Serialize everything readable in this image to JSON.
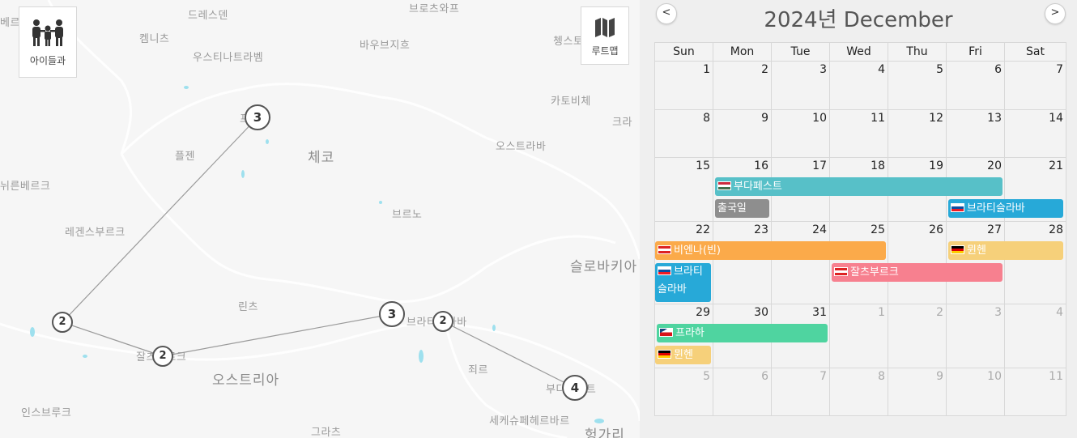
{
  "map": {
    "buttons": {
      "kids_label": "아이들과",
      "route_label": "루트맵"
    },
    "places": [
      {
        "id": "dresden",
        "text": "드레스덴"
      },
      {
        "id": "bros",
        "text": "브로츠와프"
      },
      {
        "id": "chemnitz",
        "text": "켐니츠"
      },
      {
        "id": "bautzen",
        "text": "바우브지흐"
      },
      {
        "id": "chenst",
        "text": "쳉스토"
      },
      {
        "id": "usti",
        "text": "우스티나트라벰"
      },
      {
        "id": "katowice",
        "text": "카토비체"
      },
      {
        "id": "krak",
        "text": "크라"
      },
      {
        "id": "plzen",
        "text": "플젠"
      },
      {
        "id": "czech",
        "text": "체코"
      },
      {
        "id": "ostrava",
        "text": "오스트라바"
      },
      {
        "id": "nurnberg",
        "text": "뉘른베르크"
      },
      {
        "id": "brno",
        "text": "브르노"
      },
      {
        "id": "regensburg",
        "text": "레겐스부르크"
      },
      {
        "id": "slovakia",
        "text": "슬로바키아"
      },
      {
        "id": "linz",
        "text": "린츠"
      },
      {
        "id": "austria",
        "text": "오스트리아"
      },
      {
        "id": "gyor",
        "text": "죄르"
      },
      {
        "id": "innsbruck",
        "text": "인스브루크"
      },
      {
        "id": "graz",
        "text": "그라츠"
      },
      {
        "id": "szek",
        "text": "세케슈페헤르바르"
      },
      {
        "id": "hungary",
        "text": "헝가리"
      },
      {
        "id": "bratis",
        "text": "브라티슬라바"
      },
      {
        "id": "salz",
        "text": "잘츠부르크"
      },
      {
        "id": "buda",
        "text": "부다페스트"
      },
      {
        "id": "praha",
        "text": "프라하"
      },
      {
        "id": "leftedge",
        "text": "베르"
      }
    ],
    "markers": [
      {
        "id": "praha",
        "count": "3"
      },
      {
        "id": "munich",
        "count": "2"
      },
      {
        "id": "salzburg",
        "count": "2"
      },
      {
        "id": "vienna",
        "count": "3"
      },
      {
        "id": "bratislava",
        "count": "2"
      },
      {
        "id": "budapest",
        "count": "4"
      }
    ]
  },
  "calendar": {
    "title": "2024년 December",
    "prev_label": "<",
    "next_label": ">",
    "weekdays": [
      "Sun",
      "Mon",
      "Tue",
      "Wed",
      "Thu",
      "Fri",
      "Sat"
    ],
    "weeks": [
      [
        {
          "d": "1"
        },
        {
          "d": "2"
        },
        {
          "d": "3"
        },
        {
          "d": "4"
        },
        {
          "d": "5"
        },
        {
          "d": "6"
        },
        {
          "d": "7"
        }
      ],
      [
        {
          "d": "8"
        },
        {
          "d": "9"
        },
        {
          "d": "10"
        },
        {
          "d": "11"
        },
        {
          "d": "12"
        },
        {
          "d": "13"
        },
        {
          "d": "14"
        }
      ],
      [
        {
          "d": "15"
        },
        {
          "d": "16"
        },
        {
          "d": "17"
        },
        {
          "d": "18"
        },
        {
          "d": "19"
        },
        {
          "d": "20"
        },
        {
          "d": "21"
        }
      ],
      [
        {
          "d": "22"
        },
        {
          "d": "23"
        },
        {
          "d": "24"
        },
        {
          "d": "25"
        },
        {
          "d": "26"
        },
        {
          "d": "27"
        },
        {
          "d": "28"
        }
      ],
      [
        {
          "d": "29"
        },
        {
          "d": "30"
        },
        {
          "d": "31"
        },
        {
          "d": "1",
          "other": true
        },
        {
          "d": "2",
          "other": true
        },
        {
          "d": "3",
          "other": true
        },
        {
          "d": "4",
          "other": true
        }
      ],
      [
        {
          "d": "5",
          "other": true
        },
        {
          "d": "6",
          "other": true
        },
        {
          "d": "7",
          "other": true
        },
        {
          "d": "8",
          "other": true
        },
        {
          "d": "9",
          "other": true
        },
        {
          "d": "10",
          "other": true
        },
        {
          "d": "11",
          "other": true
        }
      ]
    ],
    "events": [
      {
        "label": "부다페스트",
        "color": "#57c0c8",
        "flag": "hungary",
        "start": "2024-12-16",
        "end": "2024-12-20"
      },
      {
        "label": "출국일",
        "color": "#8e8e8e",
        "flag": "",
        "start": "2024-12-16",
        "end": "2024-12-16"
      },
      {
        "label": "브라티슬라바",
        "color": "#27a9d8",
        "flag": "slovakia",
        "start": "2024-12-20",
        "end": "2024-12-21"
      },
      {
        "label": "비엔나(빈)",
        "color": "#fbaa4a",
        "flag": "austria",
        "start": "2024-12-22",
        "end": "2024-12-25"
      },
      {
        "label": "뮌헨",
        "color": "#f6d07a",
        "flag": "germany",
        "start": "2024-12-27",
        "end": "2024-12-28"
      },
      {
        "label": "브라티슬라바",
        "color": "#27a9d8",
        "flag": "slovakia",
        "start": "2024-12-22",
        "end": "2024-12-22"
      },
      {
        "label": "잘츠부르크",
        "color": "#f7808f",
        "flag": "austria",
        "start": "2024-12-25",
        "end": "2024-12-27"
      },
      {
        "label": "프라하",
        "color": "#4fd4a0",
        "flag": "czech",
        "start": "2024-12-29",
        "end": "2024-12-31"
      },
      {
        "label": "뮌헨",
        "color": "#f6d07a",
        "flag": "germany",
        "start": "2024-12-29",
        "end": "2024-12-29"
      }
    ]
  }
}
